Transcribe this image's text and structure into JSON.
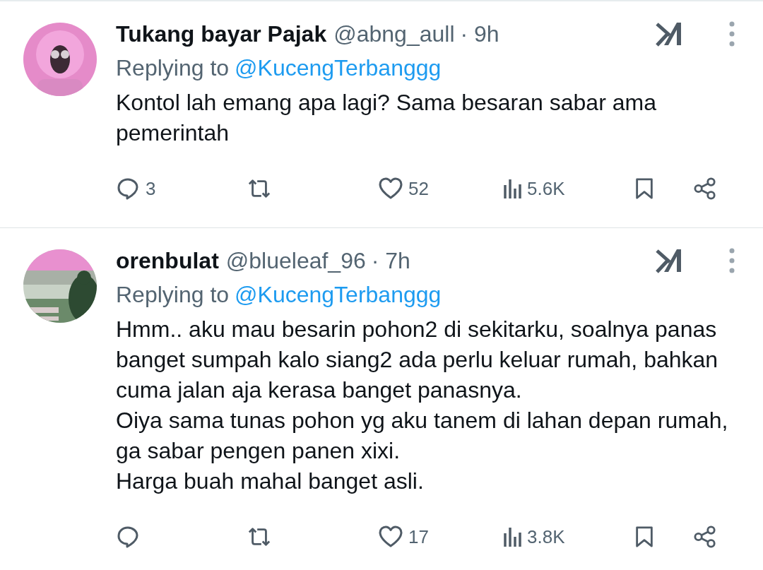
{
  "tweets": [
    {
      "name": "Tukang bayar Pajak",
      "handle": "@abng_aull",
      "time": "· 9h",
      "replying_label": "Replying to",
      "replying_to": "@KucengTerbanggg",
      "text": "Kontol lah emang apa lagi? Sama besaran sabar ama pemerintah",
      "replies": "3",
      "likes": "52",
      "views": "5.6K"
    },
    {
      "name": "orenbulat",
      "handle": "@blueleaf_96",
      "time": "· 7h",
      "replying_label": "Replying to",
      "replying_to": "@KucengTerbanggg",
      "text": "Hmm.. aku mau besarin pohon2 di sekitarku, soalnya panas banget sumpah kalo siang2 ada perlu keluar rumah, bahkan cuma jalan aja kerasa banget panasnya.\nOiya sama tunas pohon yg aku tanem di lahan depan rumah, ga sabar pengen panen xixi.\nHarga buah mahal banget asli.",
      "likes": "17",
      "views": "3.8K"
    }
  ]
}
